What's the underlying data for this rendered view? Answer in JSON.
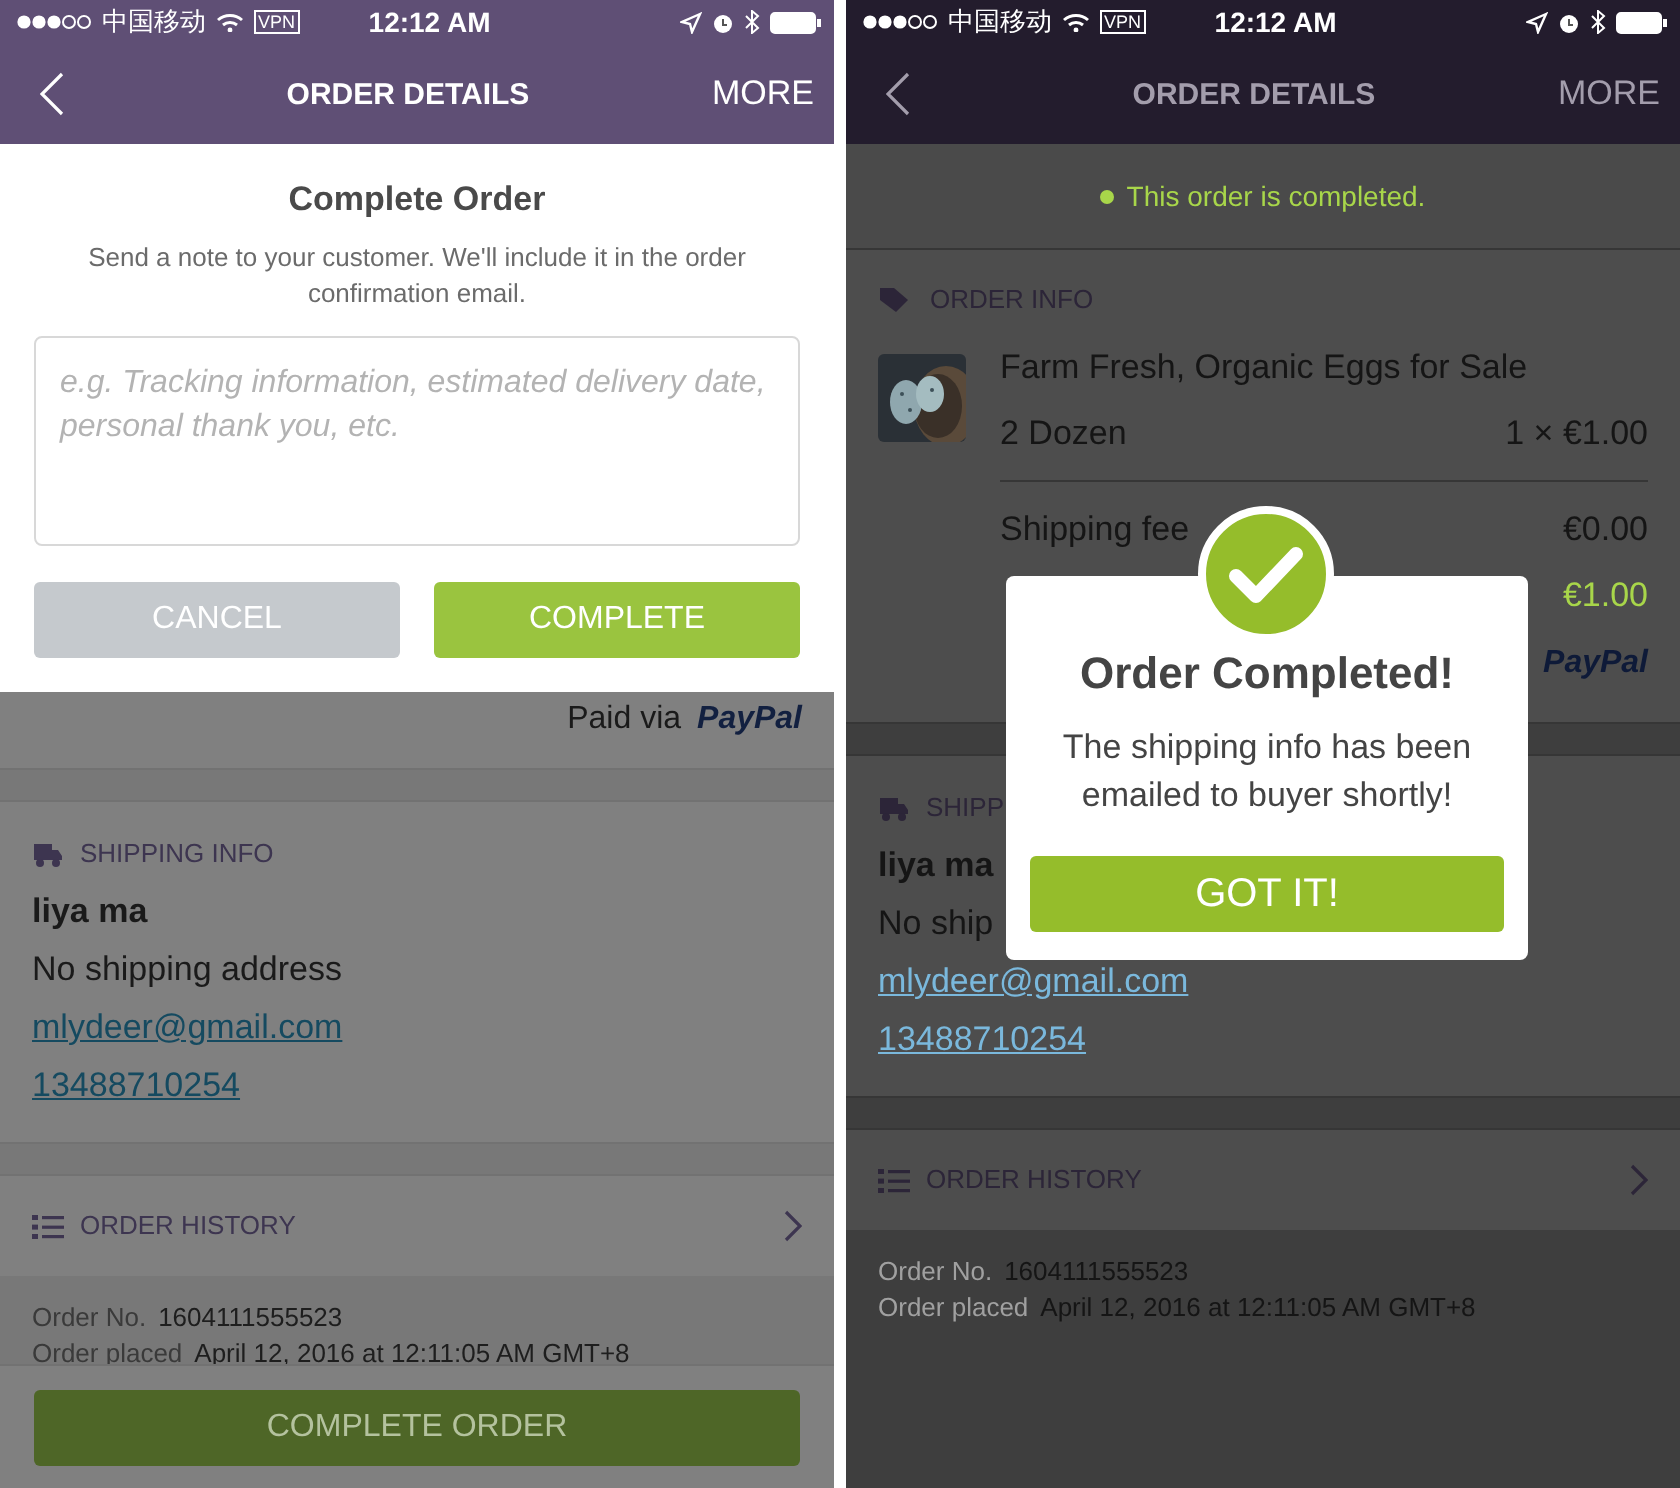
{
  "phones": [
    {
      "status_bar": {
        "carrier": "中国移动",
        "vpn": "VPN",
        "time": "12:12 AM"
      },
      "nav": {
        "title": "ORDER DETAILS",
        "action": "MORE"
      },
      "sheet": {
        "title": "Complete Order",
        "note": "Send a note to your customer. We'll include it in the order confirmation email.",
        "placeholder": "e.g. Tracking information, estimated delivery date, personal thank you, etc.",
        "buttons": [
          {
            "label": "CANCEL",
            "kind": "secondary"
          },
          {
            "label": "COMPLETE",
            "kind": "primary"
          }
        ]
      },
      "sections": [
        {
          "kind": "payment",
          "label": "Paid via",
          "brand": "PayPal"
        },
        {
          "kind": "shipping",
          "title": "SHIPPING INFO",
          "name": "liya ma",
          "address": "No shipping address",
          "email": "mlydeer@gmail.com",
          "phone": "13488710254"
        },
        {
          "kind": "history",
          "title": "ORDER HISTORY"
        },
        {
          "kind": "meta",
          "rows": [
            {
              "label": "Order No.",
              "value": "1604111555523"
            },
            {
              "label": "Order placed",
              "value": "April 12, 2016 at 12:11:05 AM GMT+8"
            }
          ]
        }
      ],
      "bottom_button": "COMPLETE ORDER"
    },
    {
      "status_bar": {
        "carrier": "中国移动",
        "vpn": "VPN",
        "time": "12:12 AM"
      },
      "nav": {
        "title": "ORDER DETAILS",
        "action": "MORE"
      },
      "sections": [
        {
          "kind": "banner",
          "text": "This order is completed."
        },
        {
          "kind": "order",
          "title": "ORDER INFO",
          "item": {
            "title": "Farm Fresh, Organic Eggs for Sale",
            "variant": "2 Dozen",
            "price": "1 × €1.00"
          },
          "fee": {
            "label": "Shipping fee",
            "value": "€0.00"
          },
          "total": "€1.00",
          "brand": "PayPal"
        },
        {
          "kind": "shipping",
          "title": "SHIPP",
          "name": "liya ma",
          "address": "No ship",
          "email": "mlydeer@gmail.com",
          "phone": "13488710254"
        },
        {
          "kind": "history",
          "title": "ORDER HISTORY"
        },
        {
          "kind": "meta",
          "rows": [
            {
              "label": "Order No.",
              "value": "1604111555523"
            },
            {
              "label": "Order placed",
              "value": "April 12, 2016 at 12:11:05 AM GMT+8"
            }
          ]
        }
      ],
      "dialog": {
        "title": "Order Completed!",
        "message": "The shipping info has been emailed to buyer shortly!",
        "button": "GOT IT!"
      }
    }
  ]
}
